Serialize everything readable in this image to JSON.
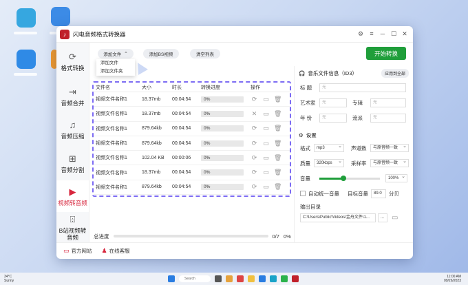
{
  "window": {
    "title": "闪电音频格式转换器",
    "controls": [
      "⚙",
      "≡",
      "─",
      "☐",
      "✕"
    ]
  },
  "sidebar": {
    "items": [
      {
        "label": "格式转换",
        "icon": "refresh-icon"
      },
      {
        "label": "音频合并",
        "icon": "merge-icon"
      },
      {
        "label": "音频压缩",
        "icon": "compress-icon"
      },
      {
        "label": "音频分割",
        "icon": "split-icon"
      },
      {
        "label": "视频转音频",
        "icon": "video-icon"
      },
      {
        "label": "B站视频转音频",
        "icon": "bilibili-icon"
      }
    ]
  },
  "toolbar": {
    "add_file": "添加文件",
    "add_audio_video": "添加BS视频",
    "clear_list": "清空列表",
    "start": "开始转换",
    "dropdown": [
      "添加文件",
      "添加文件夹"
    ]
  },
  "table": {
    "headers": [
      "文件名",
      "大小",
      "时长",
      "转换进度",
      "操作"
    ],
    "rows": [
      {
        "name": "视频文件名称1",
        "size": "18.37mb",
        "duration": "00:04:54",
        "progress": "0%"
      },
      {
        "name": "视频文件名称1",
        "size": "18.37mb",
        "duration": "00:04:54",
        "progress": "0%"
      },
      {
        "name": "视频文件名称1",
        "size": "879.64kb",
        "duration": "00:04:54",
        "progress": "0%"
      },
      {
        "name": "视频文件名称1",
        "size": "879.64kb",
        "duration": "00:04:54",
        "progress": "0%"
      },
      {
        "name": "视频文件名称1",
        "size": "102.04 KB",
        "duration": "00:00:06",
        "progress": "0%"
      },
      {
        "name": "视频文件名称1",
        "size": "18.37mb",
        "duration": "00:04:54",
        "progress": "0%"
      },
      {
        "name": "视频文件名称1",
        "size": "879.64kb",
        "duration": "00:04:54",
        "progress": "0%"
      }
    ]
  },
  "total_progress": {
    "label": "总进度",
    "count": "0/7",
    "percent": "0%"
  },
  "info": {
    "title": "音乐文件信息（ID3）",
    "apply_all": "应用到全部",
    "fields": {
      "title": "标 题",
      "artist": "艺术家",
      "album": "专辑",
      "year": "年 份",
      "genre": "流派"
    },
    "placeholder": "无"
  },
  "settings": {
    "title": "设置",
    "format_label": "格式",
    "format_value": "mp3",
    "channels_label": "声道数",
    "channels_value": "与原音频一致",
    "quality_label": "质量",
    "quality_value": "320kbps",
    "samplerate_label": "采样率",
    "samplerate_value": "与原音频一致",
    "volume_label": "音量",
    "volume_value": "100%",
    "volume_level": 0.4,
    "auto_volume_label": "自动统一音量",
    "target_volume_label": "目标音量",
    "target_volume_value": "89.0",
    "target_volume_unit": "分贝",
    "output_label": "输出目录",
    "output_path": "C:\\Users\\Public\\Videos\\金舟文件\\1...",
    "output_btn": "..."
  },
  "footer": {
    "website": "官方网站",
    "support": "在线客服"
  },
  "taskbar": {
    "weather_temp": "34°C",
    "weather_desc": "Sunny",
    "search": "Search",
    "time": "11:00 AM",
    "date": "09/26/2023"
  }
}
